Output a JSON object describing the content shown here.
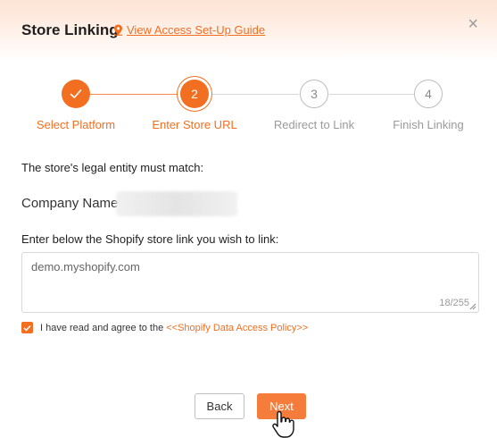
{
  "header": {
    "title": "Store Linking",
    "guide_link": "View Access Set-Up Guide",
    "close_glyph": "×"
  },
  "stepper": {
    "steps": [
      {
        "number": "",
        "label": "Select Platform",
        "status": "done"
      },
      {
        "number": "2",
        "label": "Enter Store URL",
        "status": "current"
      },
      {
        "number": "3",
        "label": "Redirect to Link",
        "status": "todo"
      },
      {
        "number": "4",
        "label": "Finish Linking",
        "status": "todo"
      }
    ]
  },
  "form": {
    "notice": "The store's legal entity must match:",
    "company_label": "Company Name:",
    "store_link_label": "Enter below the Shopify store link you wish to link:",
    "store_link_value": "demo.myshopify.com",
    "char_count": "18/255",
    "agree_text": "I have read and agree to the",
    "policy_link": "<<Shopify Data Access Policy>>",
    "agree_checked": true
  },
  "buttons": {
    "back": "Back",
    "next": "Next"
  },
  "colors": {
    "accent": "#f26f21",
    "next_button": "#f57c3a"
  }
}
